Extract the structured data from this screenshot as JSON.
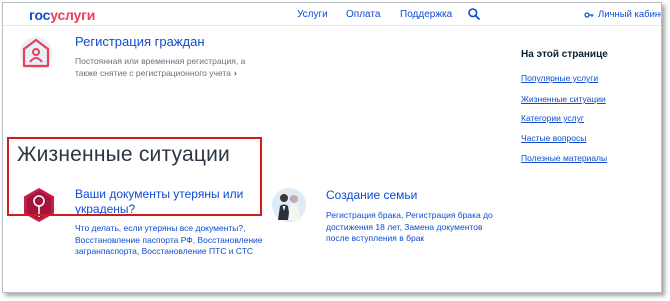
{
  "header": {
    "logo_part1": "гос",
    "logo_part2": "услуги",
    "nav": [
      "Услуги",
      "Оплата",
      "Поддержка"
    ],
    "cabinet_label": "Личный кабинет"
  },
  "registration": {
    "title": "Регистрация граждан",
    "description": "Постоянная или временная регистрация, а также снятие с регистрационного учета",
    "arrow": "›"
  },
  "sidebar": {
    "title": "На этой странице",
    "links": [
      "Популярные услуги",
      "Жизненные ситуации",
      "Категории услуг",
      "Частые вопросы",
      "Полезные материалы"
    ]
  },
  "life_situations": {
    "title": "Жизненные ситуации",
    "cards": [
      {
        "title": "Ваши документы утеряны или украдены?",
        "description": "Что делать, если утеряны все документы?, Восстановление паспорта РФ, Восстановление загранпаспорта, Восстановление ПТС и СТС"
      },
      {
        "title": "Создание семьи",
        "description": "Регистрация брака, Регистрация брака до достижения 18 лет, Замена документов после вступления в брак"
      }
    ]
  },
  "colors": {
    "brand_blue": "#0d4cd3",
    "brand_red": "#ee3f58",
    "highlight_border": "#d21c1c"
  },
  "icons": {
    "registration": "house-person-icon",
    "documents": "document-lost-icon",
    "family": "couple-icon",
    "search": "search-icon",
    "cabinet": "key-icon"
  }
}
